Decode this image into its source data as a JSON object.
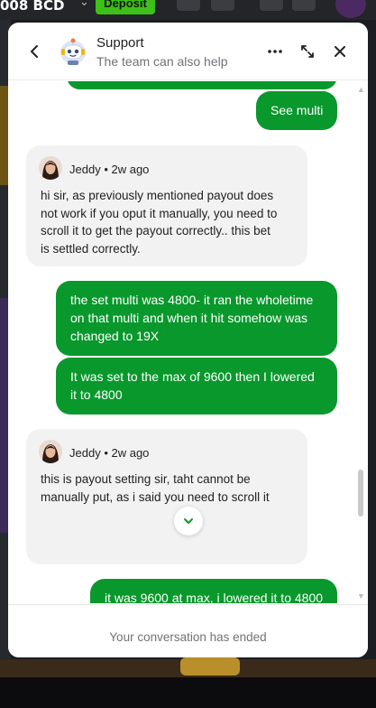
{
  "background": {
    "balance": "008 BCD",
    "deposit_label": "Deposit"
  },
  "header": {
    "title": "Support",
    "subtitle": "The team can also help"
  },
  "messages": [
    {
      "from": "user",
      "text": "See multi"
    },
    {
      "from": "agent",
      "name": "Jeddy",
      "time": "• 2w ago",
      "text": "hi sir, as previously mentioned payout does\nnot work if you oput it manually, you need to\nscroll it to get the payout correctly.. this bet\nis settled correctly."
    },
    {
      "from": "user",
      "text": "the set multi was 4800- it ran the wholetime\non that multi and when it hit somehow was\nchanged to 19X"
    },
    {
      "from": "user",
      "text": "It was set to the max of 9600 then I lowered\nit to 4800"
    },
    {
      "from": "agent",
      "name": "Jeddy",
      "time": "• 2w ago",
      "text": "this is payout setting sir, taht cannot be\nmanually put, as i said you need to scroll it"
    },
    {
      "from": "user",
      "text": "it was 9600 at max, i lowered it to 4800"
    }
  ],
  "footer": {
    "status": "Your conversation has ended"
  },
  "colors": {
    "user_bubble": "#09982c",
    "agent_bubble": "#f2f2f2",
    "brand_green": "#3bc117"
  },
  "icons": {
    "back": "chevron-left-icon",
    "more": "more-horizontal-icon",
    "expand": "expand-icon",
    "close": "close-icon",
    "scroll_down": "chevron-down-icon"
  }
}
